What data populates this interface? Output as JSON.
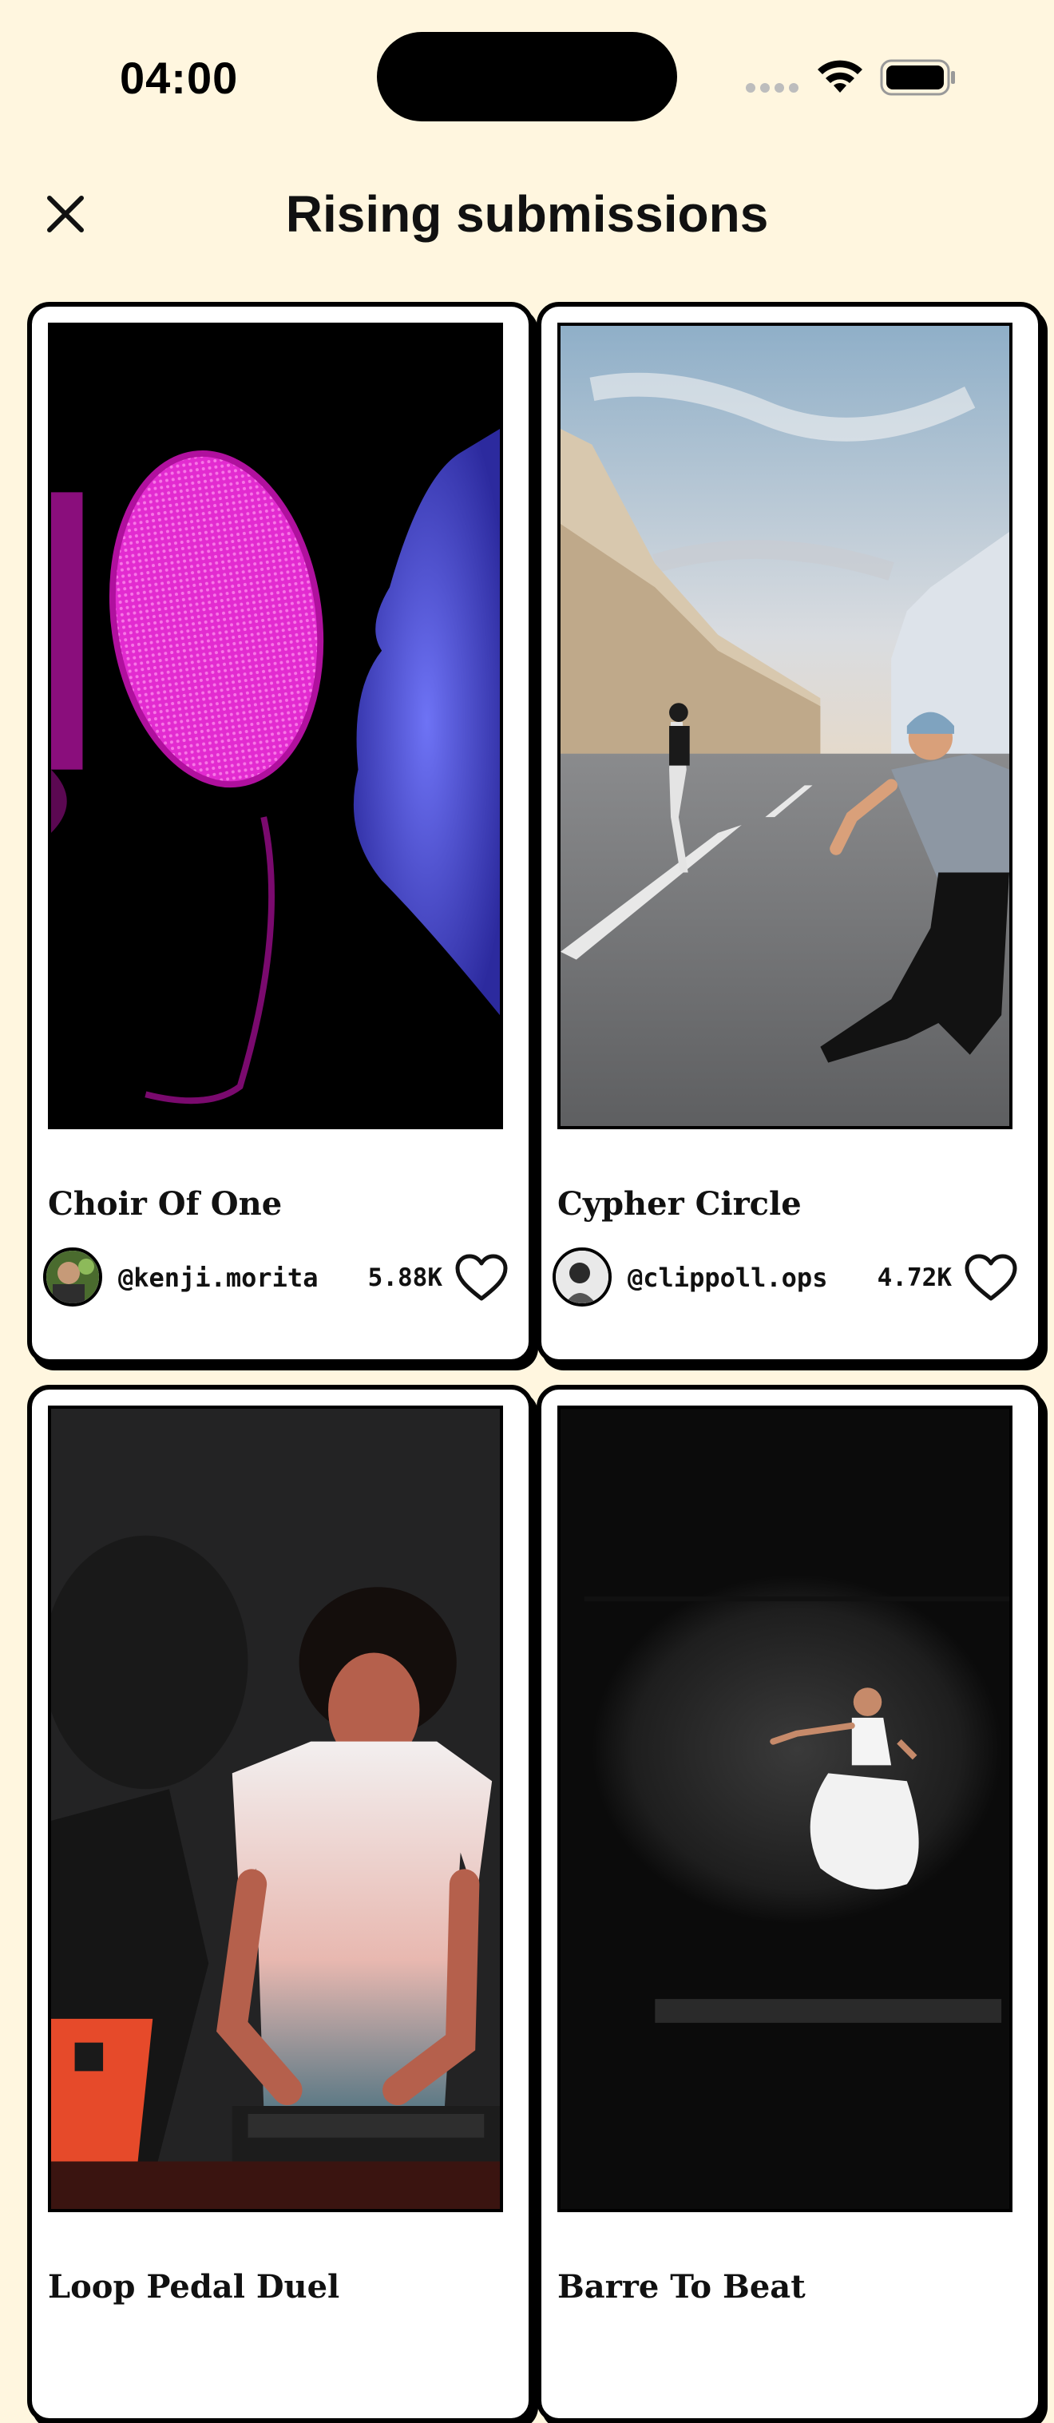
{
  "status_bar": {
    "time": "04:00"
  },
  "header": {
    "title": "Rising submissions",
    "close_icon": "close-icon"
  },
  "colors": {
    "background": "#FFF6DF",
    "card": "#FFFFFF",
    "border": "#000000"
  },
  "cards": [
    {
      "title": "Choir Of One",
      "handle": "@kenji.morita",
      "likes": "5.88K",
      "image": "microphone-silhouette"
    },
    {
      "title": "Cypher Circle",
      "handle": "@clippoll.ops",
      "likes": "4.72K",
      "image": "street-dancers"
    },
    {
      "title": "Loop Pedal Duel",
      "image": "dj-performer"
    },
    {
      "title": "Barre To Beat",
      "image": "ballet-dancer"
    }
  ]
}
